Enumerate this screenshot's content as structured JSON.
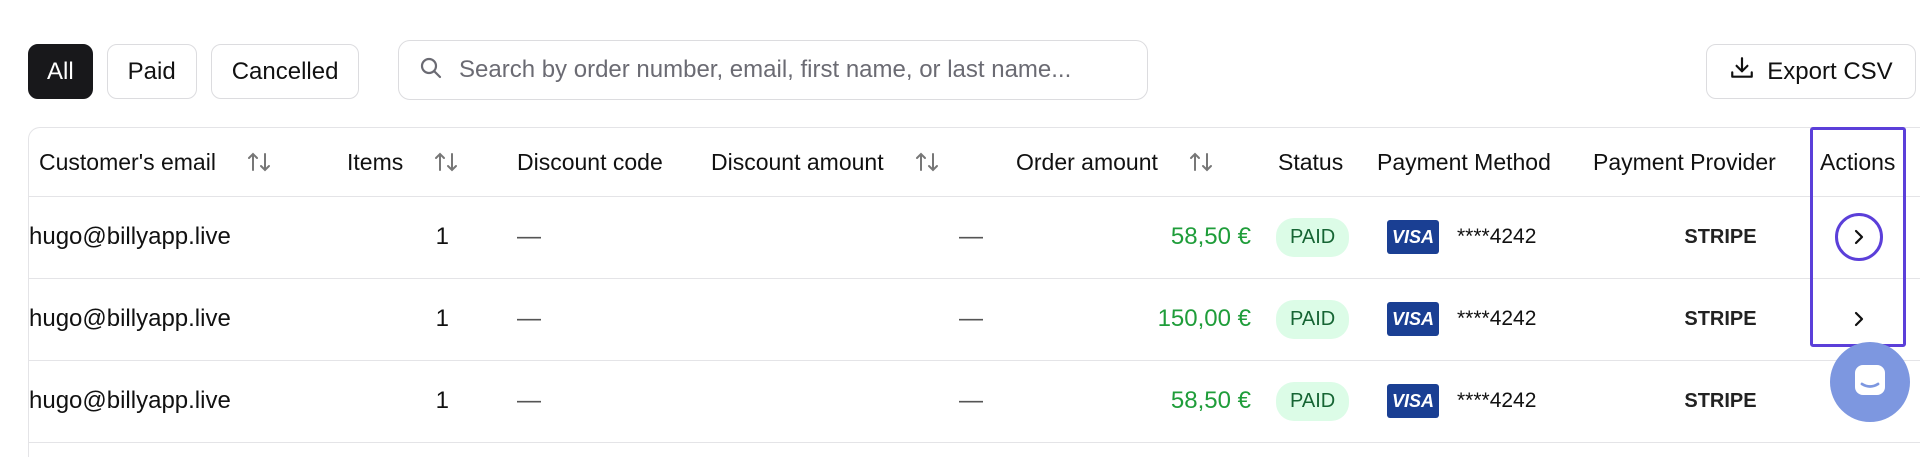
{
  "filters": [
    {
      "label": "All",
      "active": true
    },
    {
      "label": "Paid",
      "active": false
    },
    {
      "label": "Cancelled",
      "active": false
    }
  ],
  "search": {
    "placeholder": "Search by order number, email, first name, or last name..."
  },
  "export": {
    "label": "Export CSV"
  },
  "table": {
    "headers": {
      "email": "Customer's email",
      "items": "Items",
      "discount_code": "Discount code",
      "discount_amount": "Discount amount",
      "order_amount": "Order amount",
      "status": "Status",
      "payment_method": "Payment Method",
      "payment_provider": "Payment Provider",
      "actions": "Actions"
    },
    "rows": [
      {
        "email": "hugo@billyapp.live",
        "items": "1",
        "discount_code": "—",
        "discount_amount": "—",
        "order_amount": "58,50 €",
        "status": "PAID",
        "card_brand": "VISA",
        "card_number": "****4242",
        "provider": "STRIPE"
      },
      {
        "email": "hugo@billyapp.live",
        "items": "1",
        "discount_code": "—",
        "discount_amount": "—",
        "order_amount": "150,00 €",
        "status": "PAID",
        "card_brand": "VISA",
        "card_number": "****4242",
        "provider": "STRIPE"
      },
      {
        "email": "hugo@billyapp.live",
        "items": "1",
        "discount_code": "—",
        "discount_amount": "—",
        "order_amount": "58,50 €",
        "status": "PAID",
        "card_brand": "VISA",
        "card_number": "****4242",
        "provider": "STRIPE"
      }
    ]
  },
  "colors": {
    "accent": "#5b3fd9",
    "paid_text": "#166534",
    "paid_bg": "#dcfce7",
    "amount": "#1f9d3a",
    "visa": "#1a3f93"
  }
}
